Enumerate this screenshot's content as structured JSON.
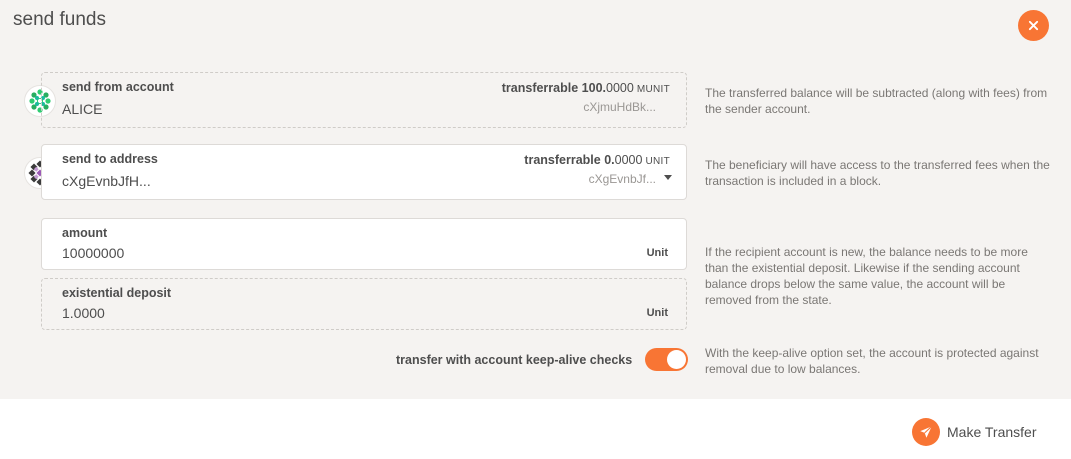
{
  "modal": {
    "title": "send funds",
    "accent_color": "#f87534"
  },
  "from": {
    "label": "send from account",
    "value": "ALICE",
    "transferrable_label": "transferrable",
    "transferrable_int": "100.",
    "transferrable_frac": "0000",
    "transferrable_unit": "MUNIT",
    "address_short": "cXjmuHdBk...",
    "help": "The transferred balance will be subtracted (along with fees) from the sender account."
  },
  "to": {
    "label": "send to address",
    "value": "cXgEvnbJfH...",
    "transferrable_label": "transferrable",
    "transferrable_int": "0.",
    "transferrable_frac": "0000",
    "transferrable_unit": "UNIT",
    "address_short": "cXgEvnbJf...",
    "help": "The beneficiary will have access to the transferred fees when the transaction is included in a block."
  },
  "amount": {
    "label": "amount",
    "value": "10000000",
    "unit": "Unit"
  },
  "deposit": {
    "label": "existential deposit",
    "value": "1.0000",
    "unit": "Unit",
    "help": "If the recipient account is new, the balance needs to be more than the existential deposit. Likewise if the sending account balance drops below the same value, the account will be removed from the state."
  },
  "keepalive": {
    "label": "transfer with account keep-alive checks",
    "enabled": true,
    "help": "With the keep-alive option set, the account is protected against removal due to low balances."
  },
  "actions": {
    "submit_label": "Make Transfer"
  }
}
